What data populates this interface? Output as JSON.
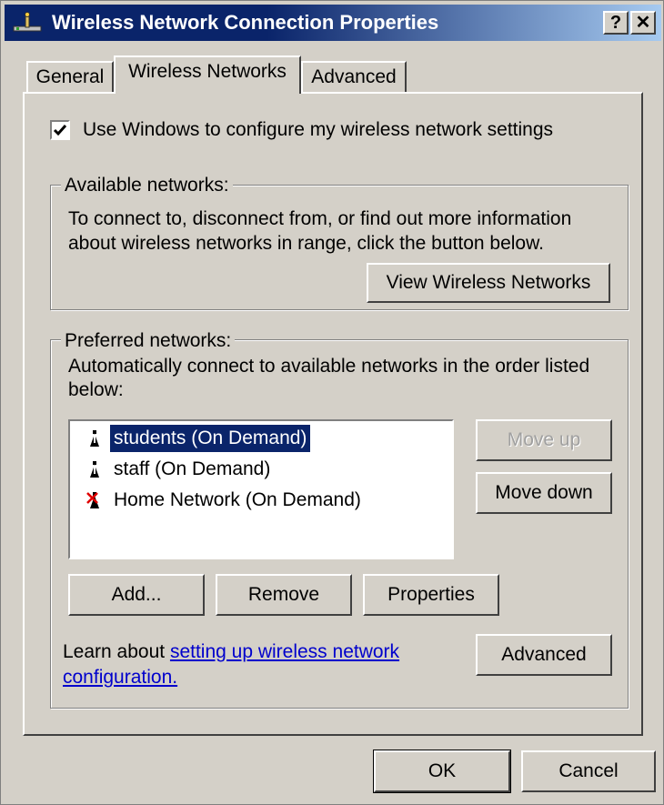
{
  "window": {
    "title": "Wireless Network Connection Properties",
    "help_button": "?",
    "close_button": "✕"
  },
  "tabs": [
    {
      "label": "General",
      "active": false
    },
    {
      "label": "Wireless Networks",
      "active": true
    },
    {
      "label": "Advanced",
      "active": false
    }
  ],
  "config": {
    "use_windows_label": "Use Windows to configure my wireless network settings",
    "use_windows_checked": true
  },
  "available": {
    "legend": "Available networks:",
    "description_line1": "To connect to, disconnect from, or find out more information",
    "description_line2": "about wireless networks in range, click the button below.",
    "view_button": "View Wireless Networks"
  },
  "preferred": {
    "legend": "Preferred networks:",
    "description_line1": "Automatically connect to available networks in the order listed",
    "description_line2": "below:",
    "networks": [
      {
        "label": "students (On Demand)",
        "selected": true,
        "icon": "antenna-icon"
      },
      {
        "label": "staff (On Demand)",
        "selected": false,
        "icon": "antenna-icon"
      },
      {
        "label": "Home Network (On Demand)",
        "selected": false,
        "icon": "antenna-unavailable-icon"
      }
    ],
    "move_up": "Move up",
    "move_down": "Move down",
    "add": "Add...",
    "remove": "Remove",
    "properties": "Properties",
    "learn_prefix": "Learn about ",
    "learn_link_line1": "setting up wireless network",
    "learn_link_line2": "configuration.",
    "advanced": "Advanced"
  },
  "footer": {
    "ok": "OK",
    "cancel": "Cancel"
  },
  "colors": {
    "titlebar": "#0a246a",
    "face": "#d4d0c8",
    "selection": "#0a246a",
    "link": "#0000cc"
  }
}
